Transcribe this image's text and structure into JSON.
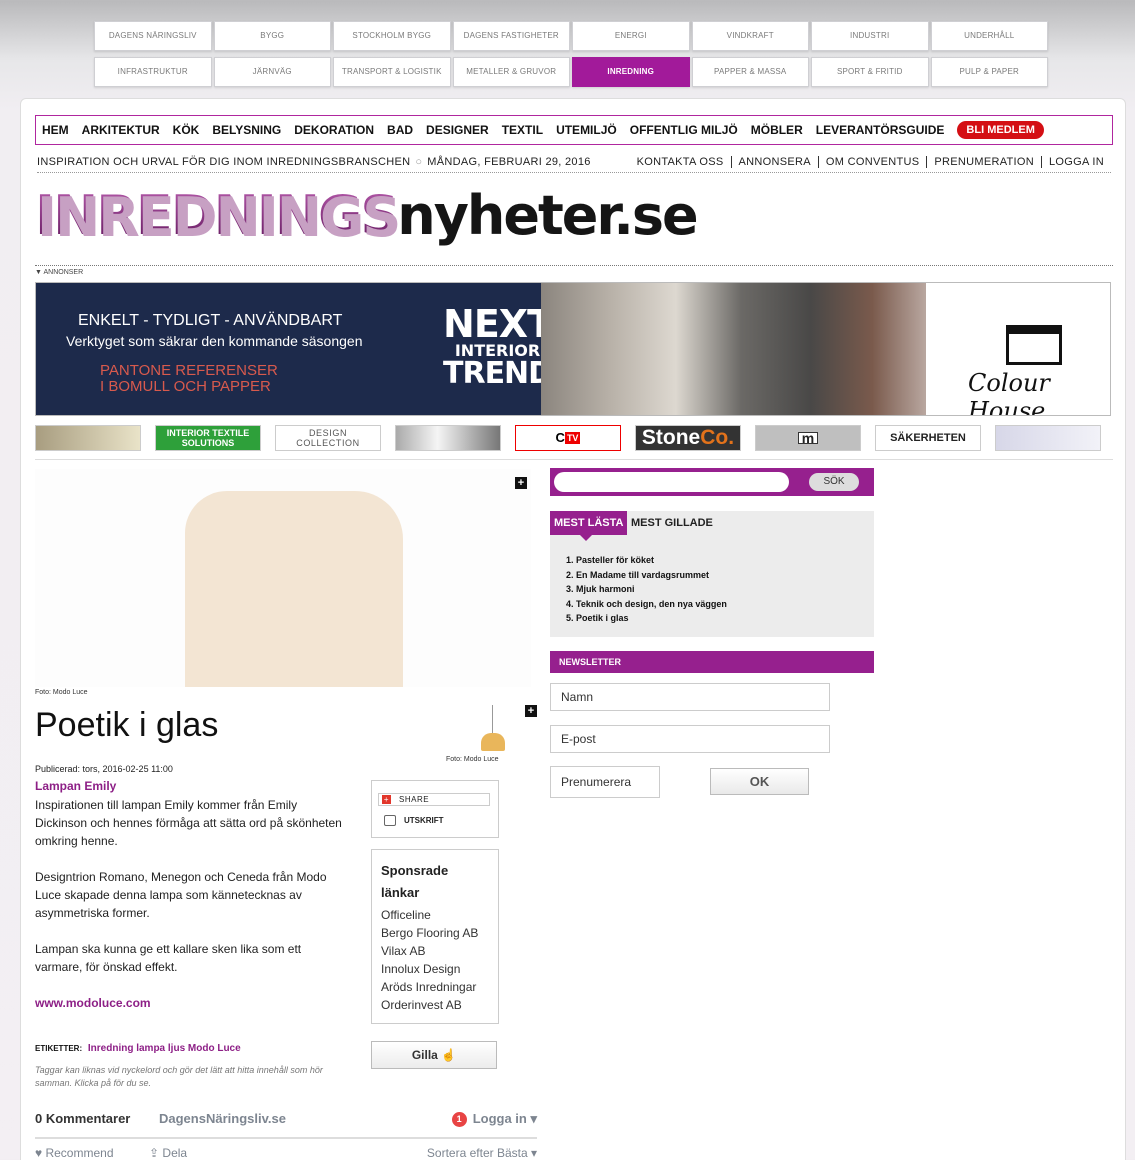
{
  "network": {
    "row1": [
      "DAGENS NÄRINGSLIV",
      "BYGG",
      "STOCKHOLM BYGG",
      "DAGENS FASTIGHETER",
      "ENERGI",
      "VINDKRAFT",
      "INDUSTRI",
      "UNDERHÅLL"
    ],
    "row2": [
      "INFRASTRUKTUR",
      "JÄRNVÄG",
      "TRANSPORT & LOGISTIK",
      "METALLER & GRUVOR",
      "INREDNING",
      "PAPPER & MASSA",
      "SPORT & FRITID",
      "PULP & PAPER"
    ],
    "active": "INREDNING"
  },
  "nav": {
    "items": [
      "HEM",
      "ARKITEKTUR",
      "KÖK",
      "BELYSNING",
      "DEKORATION",
      "BAD",
      "DESIGNER",
      "TEXTIL",
      "UTEMILJÖ",
      "OFFENTLIG MILJÖ",
      "MÖBLER",
      "LEVERANTÖRSGUIDE"
    ],
    "member": "BLI MEDLEM"
  },
  "tagline": {
    "text": "INSPIRATION OCH URVAL FÖR DIG INOM INREDNINGSBRANSCHEN",
    "date": "MÅNDAG, FEBRUARI 29, 2016",
    "links": [
      "KONTAKTA OSS",
      "ANNONSERA",
      "OM CONVENTUS",
      "PRENUMERATION",
      "LOGGA IN"
    ]
  },
  "logo": {
    "part1": "INREDNINGS",
    "part2": "nyheter.se"
  },
  "ads": {
    "label": "▼ ANNONSER",
    "banner_line1": "ENKELT - TYDLIGT - ANVÄNDBART",
    "banner_line2": "Verktyget som säkrar den kommande säsongen",
    "banner_line3": "PANTONE REFERENSER",
    "banner_line4": "I BOMULL OCH PAPPER",
    "next1": "NEXT",
    "next2": "INTERIOR",
    "next3": "TREND",
    "brand": "Colour House."
  },
  "partners": {
    "interior": "INTERIOR TEXTILE SOLUTIONS",
    "design": "DESIGN COLLECTION",
    "ctv_c": "C",
    "ctv_tv": "TV",
    "stone_a": "Stone",
    "stone_b": "Co.",
    "m": "m",
    "sak": "SÄKERHETEN"
  },
  "article": {
    "photo_credit": "Foto: Modo Luce",
    "thumb_credit": "Foto: Modo Luce",
    "title": "Poetik i glas",
    "published": "Publicerad: tors, 2016-02-25 11:00",
    "byline": "Lampan Emily",
    "p1": "Inspirationen till lampan Emily kommer från Emily Dickinson och hennes förmåga att sätta ord på skönheten omkring henne.",
    "p2": "Designtrion Romano, Menegon och Ceneda från Modo Luce skapade denna lampa som kännetecknas av asymmetriska former.",
    "p3": "Lampan ska kunna ge ett kallare sken lika som ett varmare, för önskad effekt.",
    "url": "www.modoluce.com",
    "tags_label": "ETIKETTER:",
    "tags": "Inredning lampa ljus Modo Luce",
    "tags_note": "Taggar kan liknas vid nyckelord och gör det lätt att hitta innehåll som hör samman. Klicka på för du se."
  },
  "share": {
    "share_label": "SHARE",
    "print_label": "UTSKRIFT"
  },
  "sponsored": {
    "heading1": "Sponsrade",
    "heading2": "länkar",
    "links": [
      "Officeline",
      "Bergo Flooring AB",
      "Vilax AB",
      "Innolux Design",
      "Aröds Inredningar",
      "Orderinvest AB"
    ]
  },
  "gilla": "Gilla",
  "comments": {
    "count": "0 Kommentarer",
    "site": "DagensNäringsliv.se",
    "login": "Logga in",
    "badge": "1",
    "recommend": "Recommend",
    "share": "Dela",
    "sort": "Sortera efter Bästa"
  },
  "search": {
    "button": "SÖK"
  },
  "most": {
    "tab1": "MEST LÄSTA",
    "tab2": "MEST GILLADE",
    "items": [
      "1. Pasteller för köket",
      "2. En Madame till vardagsrummet",
      "3. Mjuk harmoni",
      "4. Teknik och design, den nya väggen",
      "5. Poetik i glas"
    ]
  },
  "newsletter": {
    "heading": "NEWSLETTER",
    "name": "Namn",
    "email": "E-post",
    "subscribe": "Prenumerera",
    "ok": "OK"
  }
}
